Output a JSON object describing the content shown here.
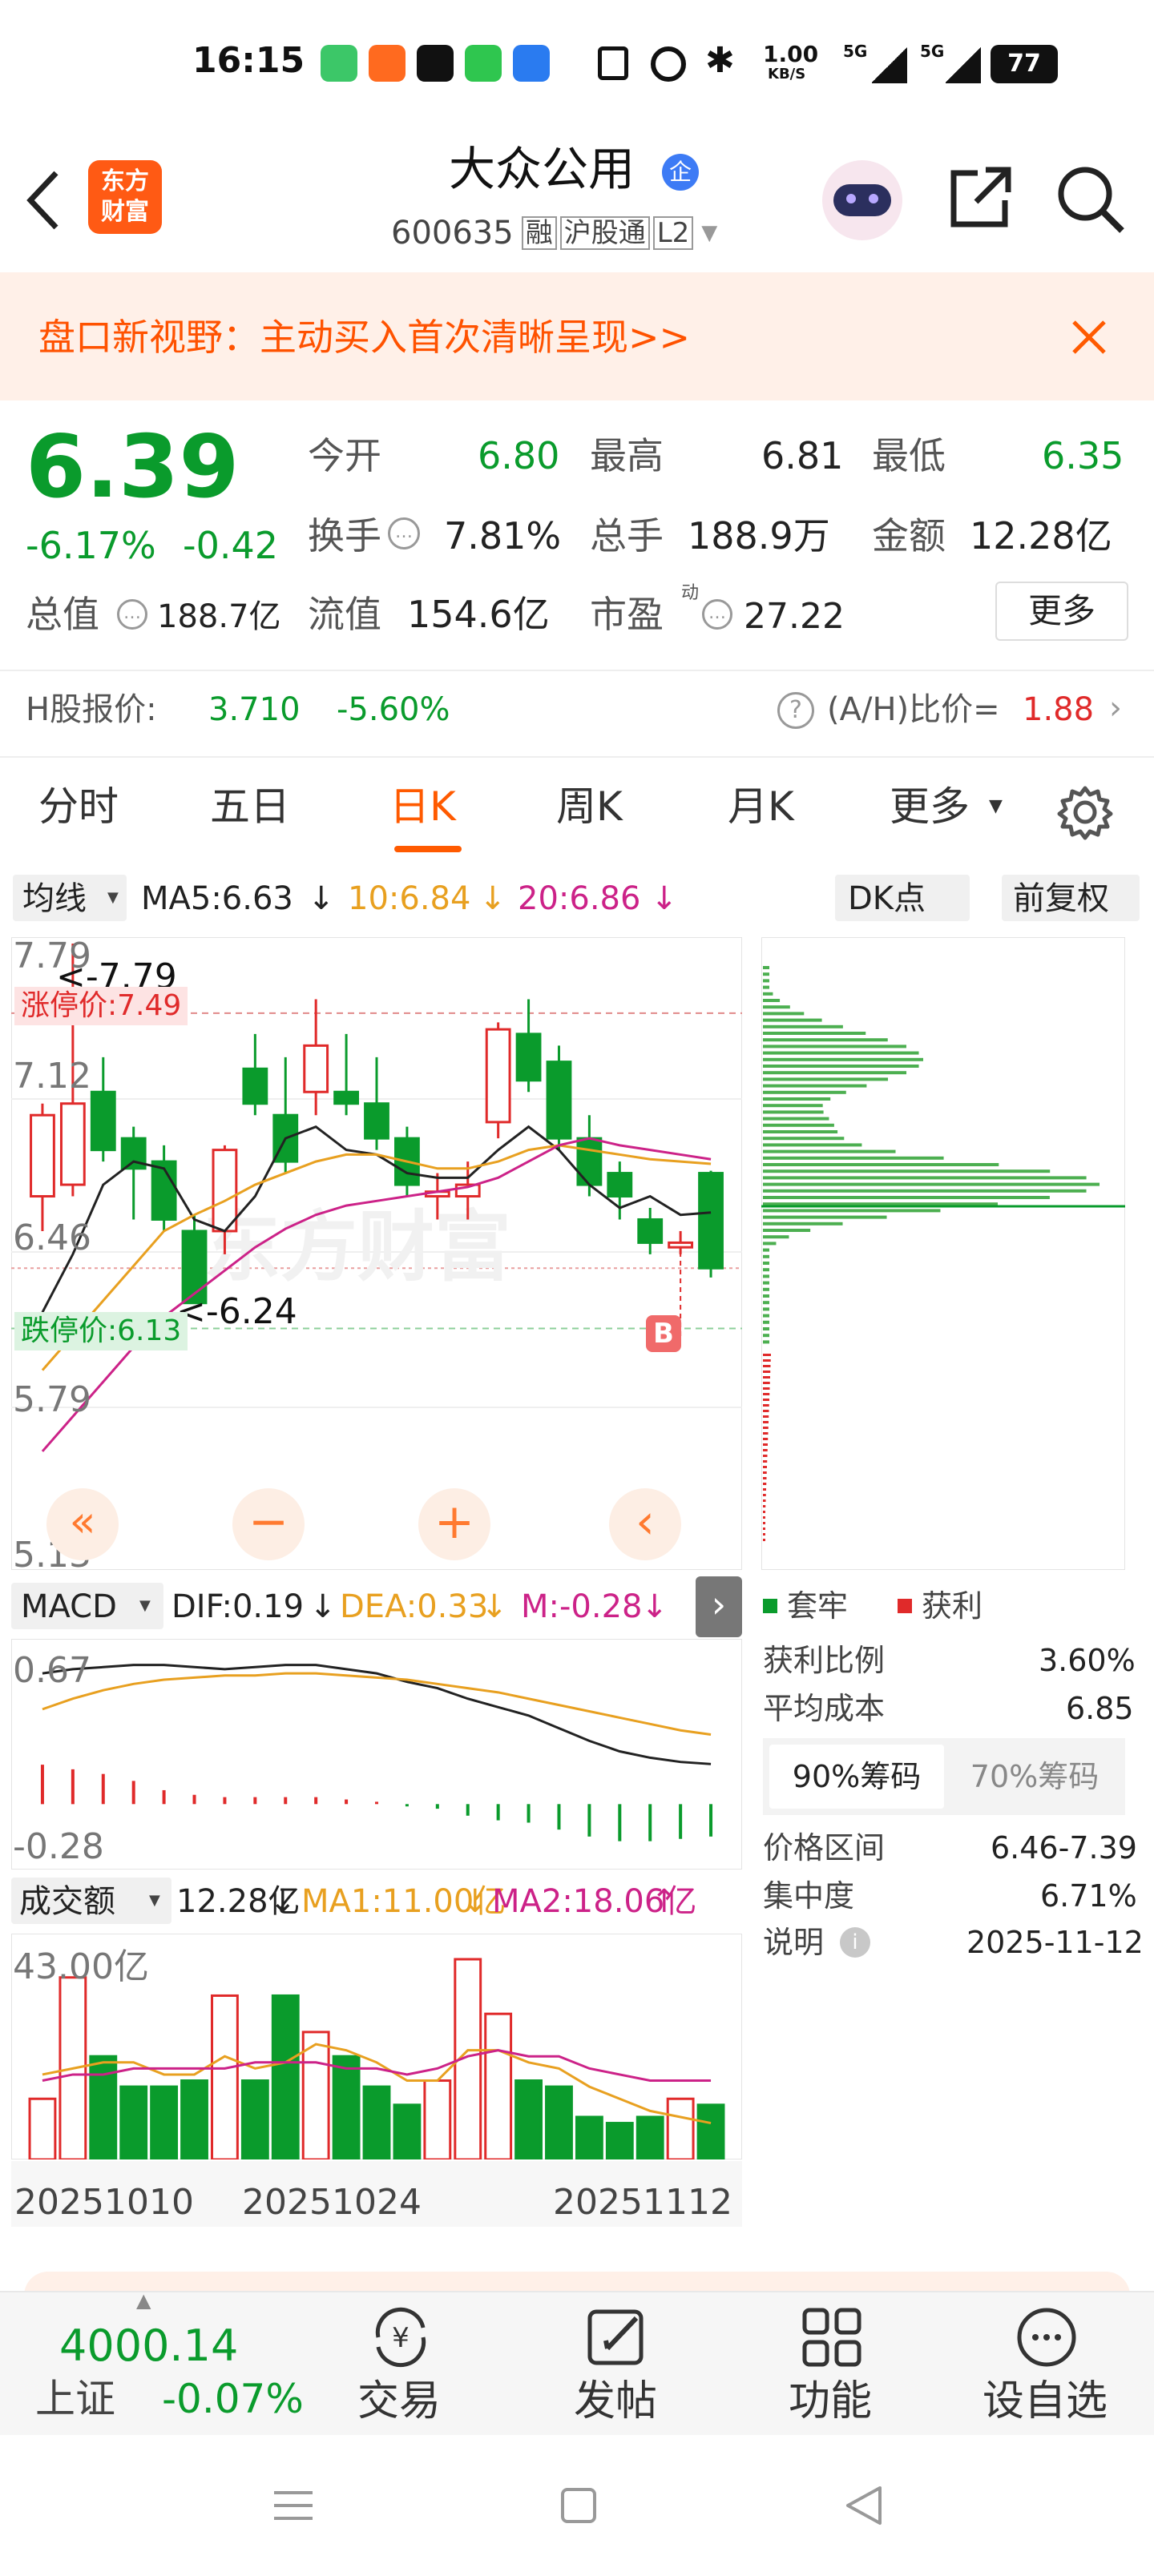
{
  "status": {
    "time": "16:15",
    "net_speed": "1.00",
    "net_unit": "KB/S",
    "sig1": "5G",
    "sig2": "5G",
    "battery": "77"
  },
  "header": {
    "brand_line1": "东方",
    "brand_line2": "财富",
    "stock_name": "大众公用",
    "badge": "企",
    "code": "600635",
    "tags": [
      "融",
      "沪股通",
      "L2"
    ]
  },
  "banner": {
    "text": "盘口新视野：主动买入首次清晰呈现>>"
  },
  "quote": {
    "price": "6.39",
    "change_pct": "-6.17%",
    "change": "-0.42",
    "open_label": "今开",
    "open": "6.80",
    "high_label": "最高",
    "high": "6.81",
    "low_label": "最低",
    "low": "6.35",
    "turnover_label": "换手",
    "turnover": "7.81%",
    "volume_label": "总手",
    "volume": "188.9万",
    "amount_label": "金额",
    "amount": "12.28亿",
    "mktcap_label": "总值",
    "mktcap": "188.7亿",
    "float_label": "流值",
    "float": "154.6亿",
    "pe_label": "市盈",
    "pe_sup": "动",
    "pe": "27.22",
    "more": "更多"
  },
  "hshare": {
    "label": "H股报价:",
    "price": "3.710",
    "pct": "-5.60%",
    "ratio_label": "(A/H)比价=",
    "ratio": "1.88"
  },
  "tabs": [
    "分时",
    "五日",
    "日K",
    "周K",
    "月K",
    "更多"
  ],
  "active_tab": 2,
  "indicator_bar": {
    "ma_select": "均线",
    "ma5": "MA5:6.63",
    "ma10": "10:6.84",
    "ma20": "20:6.86",
    "dk": "DK点",
    "fq": "前复权"
  },
  "kchart": {
    "y_labels": [
      "7.79",
      "7.12",
      "6.46",
      "5.79",
      "5.13"
    ],
    "high_mark": "<-7.79",
    "low_mark": "<-6.24",
    "limit_up": "涨停价:7.49",
    "limit_down": "跌停价:6.13",
    "watermark": "东方财富",
    "b_mark": "B"
  },
  "macd": {
    "select": "MACD",
    "dif": "DIF:0.19",
    "dea": "DEA:0.33",
    "m": "M:-0.28",
    "top": "0.67",
    "bottom": "-0.28"
  },
  "vol": {
    "select": "成交额",
    "value": "12.28亿",
    "ma1": "MA1:11.00亿",
    "ma2": "MA2:18.06亿",
    "top": "43.00亿",
    "dates": [
      "20251010",
      "20251024",
      "20251112"
    ]
  },
  "chips": {
    "legend_trap": "套牢",
    "legend_profit": "获利",
    "profit_ratio_label": "获利比例",
    "profit_ratio": "3.60%",
    "avg_cost_label": "平均成本",
    "avg_cost": "6.85",
    "tab90": "90%筹码",
    "tab70": "70%筹码",
    "range_label": "价格区间",
    "range": "6.46-7.39",
    "conc_label": "集中度",
    "conc": "6.71%",
    "note_label": "说明",
    "date": "2025-11-12"
  },
  "bottom": {
    "index_value": "4000.14",
    "index_name": "上证",
    "index_pct": "-0.07%",
    "trade": "交易",
    "post": "发帖",
    "func": "功能",
    "watch": "设自选"
  },
  "colors": {
    "up": "#e02a2a",
    "down": "#0a9b2c",
    "accent": "#ff5a00",
    "ma5": "#222222",
    "ma10": "#e8a020",
    "ma20": "#cc2288"
  },
  "chart_data": {
    "type": "candlestick",
    "series": [
      {
        "name": "MA5",
        "values": [
          6.2,
          6.45,
          6.75,
          6.85,
          6.82,
          6.6,
          6.55,
          6.7,
          6.95,
          7.0,
          6.9,
          6.88,
          6.8,
          6.78,
          6.78,
          6.9,
          7.0,
          6.9,
          6.75,
          6.65,
          6.7,
          6.62,
          6.63
        ]
      },
      {
        "name": "MA10",
        "values": [
          5.95,
          6.1,
          6.25,
          6.4,
          6.55,
          6.62,
          6.68,
          6.75,
          6.8,
          6.85,
          6.88,
          6.88,
          6.85,
          6.82,
          6.82,
          6.85,
          6.9,
          6.92,
          6.9,
          6.88,
          6.86,
          6.85,
          6.84
        ]
      },
      {
        "name": "MA20",
        "values": [
          5.6,
          5.75,
          5.9,
          6.05,
          6.18,
          6.28,
          6.38,
          6.48,
          6.56,
          6.62,
          6.66,
          6.68,
          6.7,
          6.72,
          6.74,
          6.78,
          6.85,
          6.92,
          6.95,
          6.92,
          6.9,
          6.88,
          6.86
        ]
      }
    ],
    "candles": [
      {
        "o": 6.7,
        "c": 7.05,
        "h": 7.1,
        "l": 6.55
      },
      {
        "o": 6.75,
        "c": 7.1,
        "h": 7.79,
        "l": 6.7
      },
      {
        "o": 7.15,
        "c": 6.9,
        "h": 7.3,
        "l": 6.85
      },
      {
        "o": 6.95,
        "c": 6.82,
        "h": 7.0,
        "l": 6.6
      },
      {
        "o": 6.85,
        "c": 6.6,
        "h": 6.92,
        "l": 6.55
      },
      {
        "o": 6.55,
        "c": 6.24,
        "h": 6.62,
        "l": 6.24
      },
      {
        "o": 6.55,
        "c": 6.9,
        "h": 6.92,
        "l": 6.45
      },
      {
        "o": 7.25,
        "c": 7.1,
        "h": 7.4,
        "l": 7.05
      },
      {
        "o": 7.05,
        "c": 6.85,
        "h": 7.3,
        "l": 6.8
      },
      {
        "o": 7.15,
        "c": 7.35,
        "h": 7.55,
        "l": 7.05
      },
      {
        "o": 7.15,
        "c": 7.1,
        "h": 7.4,
        "l": 7.05
      },
      {
        "o": 7.1,
        "c": 6.95,
        "h": 7.3,
        "l": 6.9
      },
      {
        "o": 6.95,
        "c": 6.75,
        "h": 7.0,
        "l": 6.7
      },
      {
        "o": 6.7,
        "c": 6.72,
        "h": 6.8,
        "l": 6.6
      },
      {
        "o": 6.7,
        "c": 6.75,
        "h": 6.85,
        "l": 6.6
      },
      {
        "o": 7.02,
        "c": 7.42,
        "h": 7.45,
        "l": 6.95
      },
      {
        "o": 7.4,
        "c": 7.2,
        "h": 7.55,
        "l": 7.15
      },
      {
        "o": 7.28,
        "c": 6.95,
        "h": 7.35,
        "l": 6.9
      },
      {
        "o": 6.95,
        "c": 6.75,
        "h": 7.05,
        "l": 6.7
      },
      {
        "o": 6.8,
        "c": 6.7,
        "h": 6.85,
        "l": 6.6
      },
      {
        "o": 6.6,
        "c": 6.5,
        "h": 6.65,
        "l": 6.45
      },
      {
        "o": 6.48,
        "c": 6.5,
        "h": 6.55,
        "l": 6.45
      },
      {
        "o": 6.8,
        "c": 6.39,
        "h": 6.81,
        "l": 6.35
      }
    ]
  }
}
